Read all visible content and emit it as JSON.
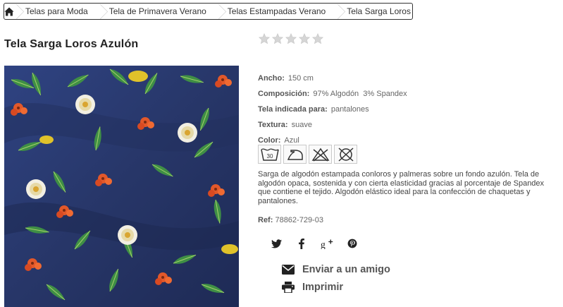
{
  "breadcrumb": {
    "home_icon": "home-icon",
    "items": [
      {
        "label": "Telas para Moda"
      },
      {
        "label": "Tela de Primavera Verano"
      },
      {
        "label": "Telas Estampadas Verano"
      },
      {
        "label": "Tela Sarga Loros Azulón"
      }
    ]
  },
  "product": {
    "title": "Tela Sarga Loros Azulón",
    "rating": {
      "value": 0,
      "max": 5
    },
    "image_alt": "Tela Sarga Loros Azulón",
    "specs": [
      {
        "label": "Ancho:",
        "value": "150 cm"
      },
      {
        "label": "Composición:",
        "value": "97% Algodón  3% Spandex"
      },
      {
        "label": "Tela indicada para:",
        "value": "pantalones"
      },
      {
        "label": "Textura:",
        "value": "suave"
      },
      {
        "label": "Color:",
        "value": "Azul"
      }
    ],
    "care_icons": [
      {
        "name": "wash-30-icon",
        "text": "30"
      },
      {
        "name": "iron-icon"
      },
      {
        "name": "no-bleach-icon"
      },
      {
        "name": "no-tumble-dry-icon"
      }
    ],
    "description": "Sarga de algodón estampada conloros y palmeras sobre un fondo azulón. Tela de algodón opaca, sostenida y con cierta elasticidad gracias al porcentaje de Spandex que contiene el tejido. Algodón elástico ideal para la confección de chaquetas y pantalones.",
    "ref_label": "Ref:",
    "ref_value": "78862-729-03"
  },
  "social": {
    "twitter": "twitter-icon",
    "facebook": "facebook-icon",
    "googleplus": "google-plus-icon",
    "pinterest": "pinterest-icon"
  },
  "actions": {
    "send_friend": "Enviar a un amigo",
    "print": "Imprimir"
  },
  "colors": {
    "star": "#d8d8d8",
    "fabric_background": "#2a3a6e"
  }
}
